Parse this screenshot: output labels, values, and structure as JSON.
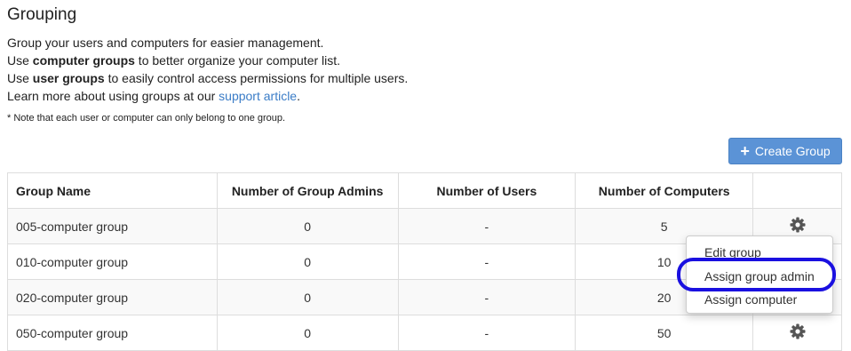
{
  "page": {
    "title": "Grouping",
    "intro_line1": "Group your users and computers for easier management.",
    "intro_line2_pre": "Use ",
    "intro_line2_bold": "computer groups",
    "intro_line2_post": " to better organize your computer list.",
    "intro_line3_pre": "Use ",
    "intro_line3_bold": "user groups",
    "intro_line3_post": " to easily control access permissions for multiple users.",
    "intro_line4_pre": "Learn more about using groups at our ",
    "intro_line4_link": "support article",
    "intro_line4_post": ".",
    "note": "* Note that each user or computer can only belong to one group."
  },
  "toolbar": {
    "create_label": "Create Group",
    "create_icon": "plus-icon"
  },
  "table": {
    "headers": [
      "Group Name",
      "Number of Group Admins",
      "Number of Users",
      "Number of Computers"
    ],
    "rows": [
      {
        "name": "005-computer group",
        "admins": "0",
        "users": "-",
        "computers": "5"
      },
      {
        "name": "010-computer group",
        "admins": "0",
        "users": "-",
        "computers": "10"
      },
      {
        "name": "020-computer group",
        "admins": "0",
        "users": "-",
        "computers": "20"
      },
      {
        "name": "050-computer group",
        "admins": "0",
        "users": "-",
        "computers": "50"
      }
    ],
    "action_icon": "gear-icon"
  },
  "dropdown": {
    "items": [
      "Edit group",
      "Assign group admin",
      "Assign computer"
    ],
    "highlighted": "Assign group admin"
  },
  "colors": {
    "accent": "#5b93d6",
    "link": "#3a7cc7",
    "highlight": "#1a10e0",
    "row_stripe": "#f9f9f9"
  }
}
